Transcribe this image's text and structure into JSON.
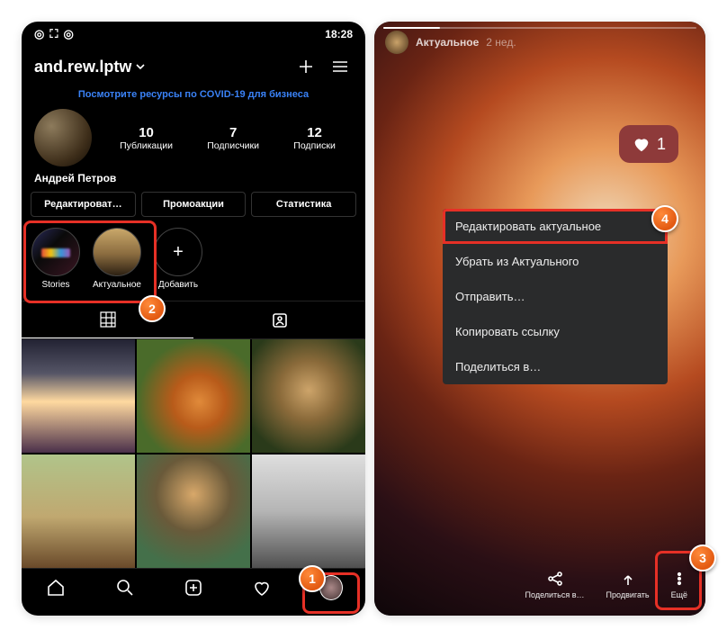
{
  "left": {
    "status_time": "18:28",
    "username": "and.rew.lptw",
    "covid": "Посмотрите ресурсы по COVID-19 для бизнеса",
    "stats": [
      {
        "num": "10",
        "label": "Публикации"
      },
      {
        "num": "7",
        "label": "Подписчики"
      },
      {
        "num": "12",
        "label": "Подписки"
      }
    ],
    "display_name": "Андрей Петров",
    "buttons": [
      "Редактироват…",
      "Промоакции",
      "Статистика"
    ],
    "highlights": [
      {
        "label": "Stories"
      },
      {
        "label": "Актуальное"
      },
      {
        "label": "Добавить"
      }
    ]
  },
  "right": {
    "story_name": "Актуальное",
    "story_time": "2 нед.",
    "like_count": "1",
    "menu": [
      "Редактировать актуальное",
      "Убрать из Актуального",
      "Отправить…",
      "Копировать ссылку",
      "Поделиться в…"
    ],
    "actions": [
      {
        "label": "Поделиться в…"
      },
      {
        "label": "Продвигать"
      },
      {
        "label": "Ещё"
      }
    ]
  },
  "badges": {
    "b1": "1",
    "b2": "2",
    "b3": "3",
    "b4": "4"
  }
}
